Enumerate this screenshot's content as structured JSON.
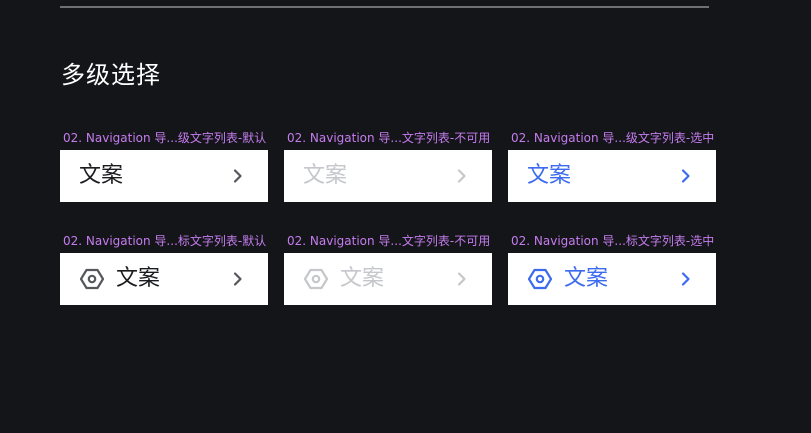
{
  "section_title": "多级选择",
  "labels": {
    "r1c1": "02. Navigation 导...级文字列表-默认",
    "r1c2": "02. Navigation 导...文字列表-不可用",
    "r1c3": "02. Navigation 导...级文字列表-选中",
    "r2c1": "02. Navigation 导...标文字列表-默认",
    "r2c2": "02. Navigation 导...文字列表-不可用",
    "r2c3": "02. Navigation 导...标文字列表-选中"
  },
  "cells": {
    "r1c1": "文案",
    "r1c2": "文案",
    "r1c3": "文案",
    "r2c1": "文案",
    "r2c2": "文案",
    "r2c3": "文案"
  },
  "colors": {
    "background": "#141518",
    "label": "#c57cf0",
    "default": "#1b1c1f",
    "disabled": "#c5c7cb",
    "selected": "#3d6bef",
    "icon_default": "#55575c"
  },
  "icons": {
    "leading": "hexagon-icon",
    "trailing": "chevron-right-icon"
  }
}
